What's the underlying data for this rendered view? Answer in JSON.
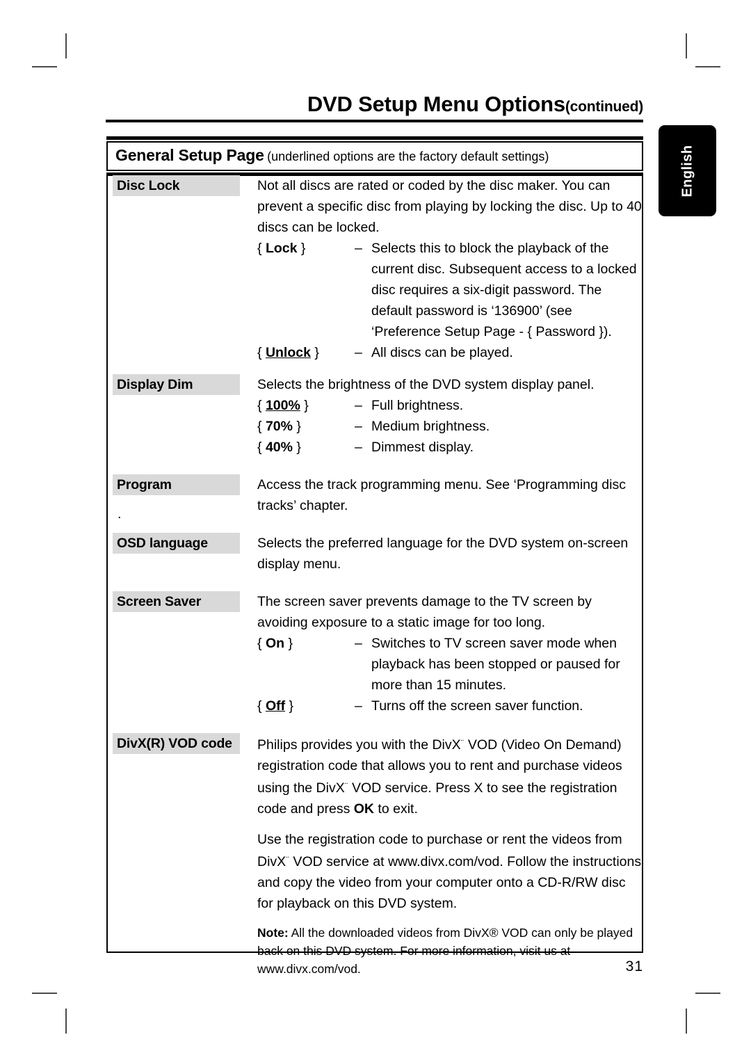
{
  "header": {
    "title_main": "DVD Setup Menu Options",
    "title_suffix": "(continued)"
  },
  "banner": {
    "title": "General Setup Page",
    "subtitle": "(underlined options are the factory default settings)"
  },
  "language_tab": {
    "label": "English"
  },
  "footer": {
    "page_number": "31"
  },
  "rows": [
    {
      "label": "Disc Lock",
      "intro": "Not all discs are rated or coded by the disc maker.  You can prevent a specific disc from playing by locking the disc.  Up to 40 discs can be locked.",
      "options": [
        {
          "key_open": "{",
          "key": "Lock",
          "key_close": "}",
          "underlined": false,
          "dash": "–",
          "desc": "Selects this to block the playback of the current disc.  Subsequent access to a locked disc requires a six-digit password.  The default password is ‘136900’ (see ‘Preference Setup Page - { Password })."
        },
        {
          "key_open": "{",
          "key": "Unlock",
          "key_close": "}",
          "underlined": true,
          "dash": "–",
          "desc": "All discs can be played."
        }
      ]
    },
    {
      "label": "Display Dim",
      "intro": "Selects the brightness of the DVD system display panel.",
      "options": [
        {
          "key_open": "{",
          "key": "100%",
          "key_close": "}",
          "underlined": true,
          "dash": "–",
          "desc": "Full brightness."
        },
        {
          "key_open": "{",
          "key": "70%",
          "key_close": "}",
          "underlined": false,
          "dash": "–",
          "desc": "Medium brightness."
        },
        {
          "key_open": "{",
          "key": "40%",
          "key_close": "}",
          "underlined": false,
          "dash": "–",
          "desc": "Dimmest display."
        }
      ]
    },
    {
      "label": "Program",
      "intro": "Access the track programming menu.  See ‘Programming disc tracks’ chapter.",
      "options": [],
      "stray_dot": "."
    },
    {
      "label": "OSD language",
      "intro": "Selects the preferred language for the DVD system on-screen display menu.",
      "options": []
    },
    {
      "label": "Screen Saver",
      "intro": "The screen saver prevents damage to the TV screen by avoiding exposure to a static image for too long.",
      "options": [
        {
          "key_open": "{",
          "key": "On",
          "key_close": "}",
          "underlined": false,
          "dash": "–",
          "desc": "Switches to TV screen saver mode when playback has been stopped or paused for more than 15 minutes."
        },
        {
          "key_open": "{",
          "key": "Off",
          "key_close": "}",
          "underlined": true,
          "dash": "–",
          "desc": "Turns off the screen saver function."
        }
      ]
    },
    {
      "label": "DivX(R) VOD code",
      "para1_a": "Philips provides you with the DivX",
      "para1_b": " VOD (Video On Demand) registration code that allows you to rent and purchase videos using the DivX",
      "para1_c": " VOD service.  Press  X to see the registration code and press ",
      "para1_ok": "OK",
      "para1_d": " to exit.",
      "para2_a": "Use the registration code to purchase or rent the videos from DivX",
      "para2_b": " VOD service at www.divx.com/vod.  Follow the instructions and copy the video from your computer onto a CD-R/RW disc for playback on this DVD system.",
      "note_label": "Note:",
      "note_text": " All the downloaded videos from DivX® VOD can only be played back on this DVD system.  For more information, visit us at www.divx.com/vod."
    }
  ]
}
